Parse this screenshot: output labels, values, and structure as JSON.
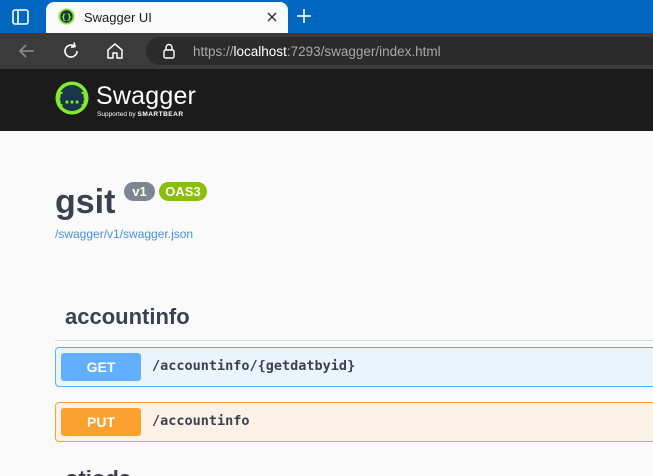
{
  "browser": {
    "tab_title": "Swagger UI",
    "url_scheme": "https://",
    "url_host": "localhost",
    "url_rest": ":7293/swagger/index.html"
  },
  "swagger": {
    "logo_text": "Swagger",
    "supported_by": "Supported by",
    "supporter": "SMARTBEAR"
  },
  "info": {
    "title": "gsit",
    "version_badge": "v1",
    "oas_badge": "OAS3",
    "spec_link": "/swagger/v1/swagger.json"
  },
  "tags": [
    {
      "name": "accountinfo",
      "operations": [
        {
          "method": "GET",
          "path": "/accountinfo/{getdatbyid}"
        },
        {
          "method": "PUT",
          "path": "/accountinfo"
        }
      ]
    }
  ],
  "next_tag_partial": "otiods",
  "colors": {
    "browser_accent": "#0067c0",
    "get": "#61affe",
    "put": "#fca130",
    "oas_badge": "#89bf04",
    "swagger_green": "#85ea2d"
  }
}
